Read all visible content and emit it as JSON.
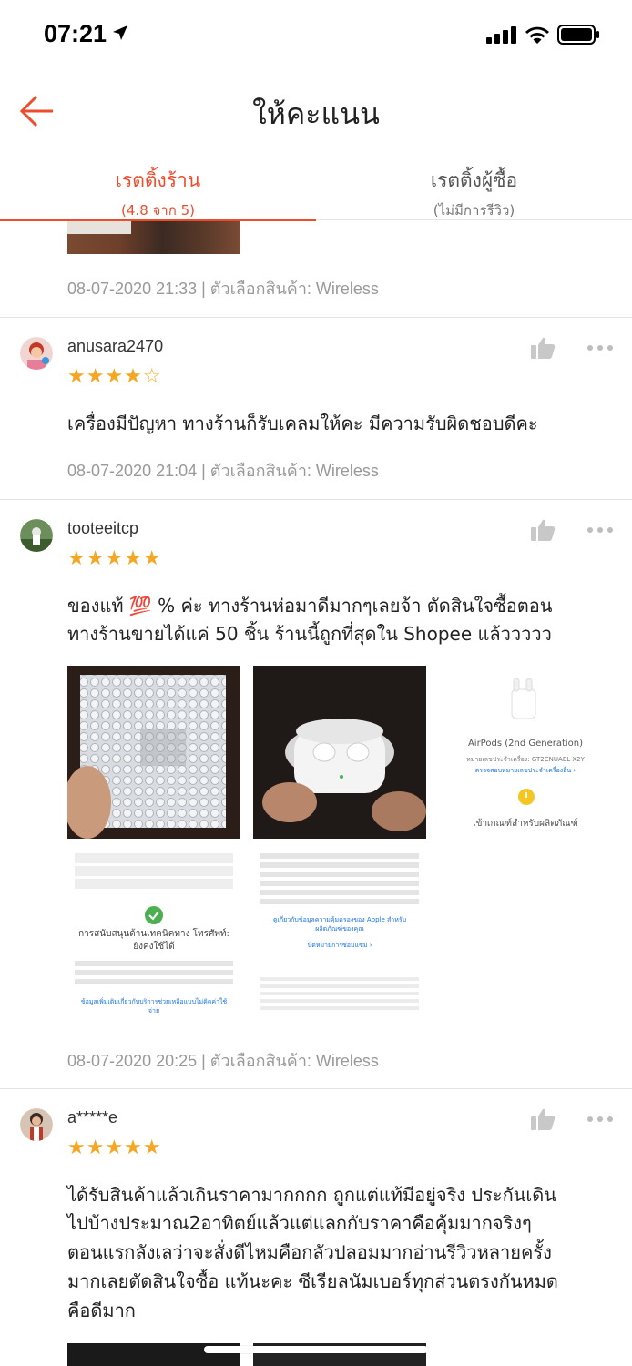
{
  "status_bar": {
    "time": "07:21"
  },
  "header": {
    "title": "ให้คะแนน"
  },
  "tabs": [
    {
      "label": "เรตติ้งร้าน",
      "sub": "(4.8 จาก 5)"
    },
    {
      "label": "เรตติ้งผู้ซื้อ",
      "sub": "(ไม่มีการรีวิว)"
    }
  ],
  "reviews": [
    {
      "meta": "08-07-2020 21:33 | ตัวเลือกสินค้า: Wireless"
    },
    {
      "username": "anusara2470",
      "rating": 4,
      "stars": "★★★★",
      "stars_empty": "☆",
      "comment": "เครื่องมีปัญหา ทางร้านก็รับเคลมให้คะ มีความรับผิดชอบดีคะ",
      "meta": "08-07-2020 21:04 | ตัวเลือกสินค้า: Wireless"
    },
    {
      "username": "tooteeitcp",
      "rating": 5,
      "stars": "★★★★★",
      "comment_line1": "ของแท้ 💯 % ค่ะ ทางร้านห่อมาดีมากๆเลยจ้า ตัดสินใจซื้อตอน",
      "comment_line2": "ทางร้านขายได้แค่ 50 ชิ้น ร้านนี้ถูกที่สุดใน Shopee แล้ววววว",
      "meta": "08-07-2020 20:25 | ตัวเลือกสินค้า: Wireless",
      "screenshot_texts": {
        "product_name": "AirPods (2nd Generation)",
        "serial": "หมายเลขประจำเครื่อง: GT2CNUAEL X2Y",
        "check_link": "ตรวจสอบหมายเลขประจำเครื่องอื่น ›",
        "eligible": "เข้าเกณฑ์สำหรับผลิตภัณฑ์",
        "support_title": "การสนับสนุนด้านเทคนิคทาง โทรศัพท์: ยังคงใช้ได้",
        "support_link": "ข้อมูลเพิ่มเติมเกี่ยวกับบริการช่วยเหลือแบบไม่คิดค่าใช้จ่าย",
        "coverage_link": "ดูเกี่ยวกับข้อมูลความคุ้มครองของ Apple สำหรับผลิตภัณฑ์ของคุณ",
        "repair_link": "นัดหมายการซ่อมแซม ›"
      }
    },
    {
      "username": "a*****e",
      "rating": 5,
      "stars": "★★★★★",
      "comment_lines": [
        "ได้รับสินค้าแล้วเกินราคามากกกก ถูกแต่แท้มีอยู่จริง ประกันเดิน",
        "ไปบ้างประมาณ2อาทิตย์แล้วแต่แลกกับราคาคือคุ้มมากจริงๆ",
        "ตอนแรกลังเลว่าจะสั่งดีไหมคือกลัวปลอมมากอ่านรีวิวหลายครั้ง",
        "มากเลยตัดสินใจซื้อ แท้นะคะ ซีเรียลนัมเบอร์ทุกส่วนตรงกันหมด",
        "คือดีมาก"
      ]
    }
  ],
  "colors": {
    "accent": "#ee4d2d",
    "star": "#f5a623",
    "meta": "#999999"
  }
}
